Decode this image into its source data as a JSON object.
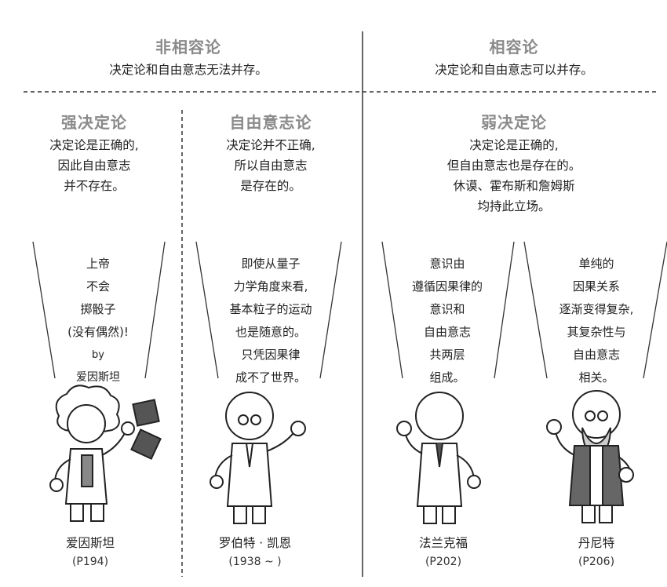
{
  "incompatibilism": {
    "title": "非相容论",
    "subtitle": "决定论和自由意志无法并存。",
    "hard_determinism": {
      "title": "强决定论",
      "lines": [
        "决定论是正确的,",
        "因此自由意志",
        "并不存在。"
      ],
      "quote": [
        "上帝",
        "不会",
        "掷骰子",
        "(没有偶然)!",
        "by",
        "爱因斯坦"
      ],
      "person": "爱因斯坦",
      "ref": "(P194)"
    },
    "libertarianism": {
      "title": "自由意志论",
      "lines": [
        "决定论并不正确,",
        "所以自由意志",
        "是存在的。"
      ],
      "quote": [
        "即使从量子",
        "力学角度来看,",
        "基本粒子的运动",
        "也是随意的。",
        "只凭因果律",
        "成不了世界。"
      ],
      "person": "罗伯特 · 凯恩",
      "ref": "(1938 ~ )"
    }
  },
  "compatibilism": {
    "title": "相容论",
    "subtitle": "决定论和自由意志可以并存。",
    "soft_determinism": {
      "title": "弱决定论",
      "lines": [
        "决定论是正确的,",
        "但自由意志也是存在的。",
        "休谟、霍布斯和詹姆斯",
        "均持此立场。"
      ]
    },
    "frankfurt": {
      "quote": [
        "意识由",
        "遵循因果律的",
        "意识和",
        "自由意志",
        "共两层",
        "组成。"
      ],
      "person": "法兰克福",
      "ref": "(P202)"
    },
    "dennett": {
      "quote": [
        "单纯的",
        "因果关系",
        "逐渐变得复杂,",
        "其复杂性与",
        "自由意志",
        "相关。"
      ],
      "person": "丹尼特",
      "ref": "(P206)"
    }
  }
}
